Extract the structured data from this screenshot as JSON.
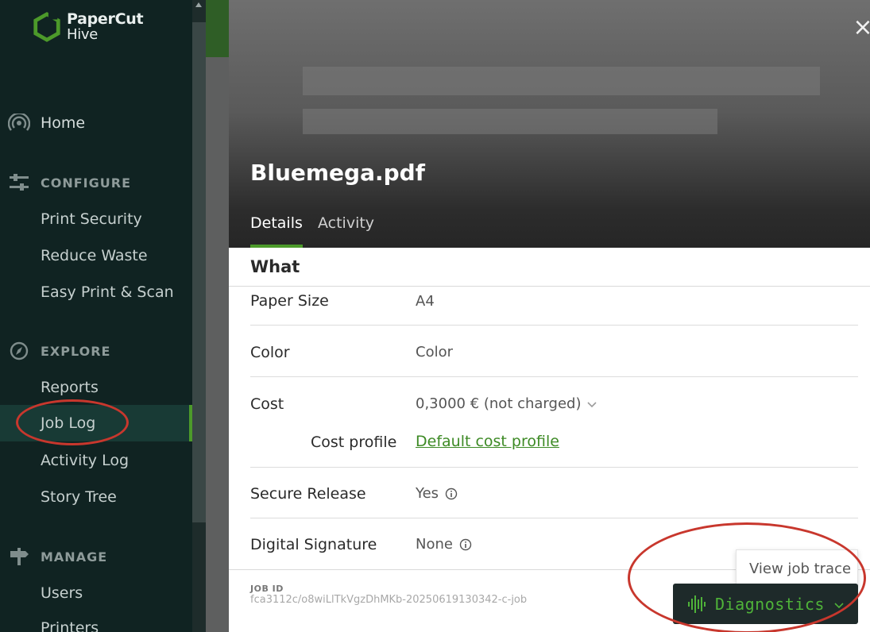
{
  "brand": {
    "line1": "PaperCut",
    "line2": "Hive",
    "mark_color": "#4c9a2a"
  },
  "sidebar": {
    "home": "Home",
    "configure": {
      "heading": "CONFIGURE",
      "items": [
        "Print Security",
        "Reduce Waste",
        "Easy Print & Scan"
      ]
    },
    "explore": {
      "heading": "EXPLORE",
      "items": [
        "Reports",
        "Job Log",
        "Activity Log",
        "Story Tree"
      ],
      "active": "Job Log"
    },
    "manage": {
      "heading": "MANAGE",
      "items": [
        "Users",
        "Printers"
      ]
    }
  },
  "drawer": {
    "close_glyph": "×",
    "title": "Bluemega.pdf",
    "tabs": [
      {
        "label": "Details",
        "active": true
      },
      {
        "label": "Activity",
        "active": false
      }
    ],
    "section_title": "What",
    "properties": {
      "paper_size": {
        "label": "Paper Size",
        "value": "A4"
      },
      "color": {
        "label": "Color",
        "value": "Color"
      },
      "cost": {
        "label": "Cost",
        "value": "0,3000 € (not charged)"
      },
      "cost_profile": {
        "label": "Cost profile",
        "value": "Default cost profile"
      },
      "secure_release": {
        "label": "Secure Release",
        "value": "Yes"
      },
      "digital_signature": {
        "label": "Digital Signature",
        "value": "None"
      }
    },
    "job_id": {
      "label": "JOB ID",
      "value": "fca3112c/o8wiLlTkVgzDhMKb-20250619130342-c-job"
    },
    "tooltip": "View job trace",
    "diagnostics_label": "Diagnostics"
  },
  "colors": {
    "accent_green": "#4c9a2a",
    "sidebar_bg": "#102322",
    "annotation_red": "#c8372d",
    "diagnostics_text": "#4fb339"
  }
}
